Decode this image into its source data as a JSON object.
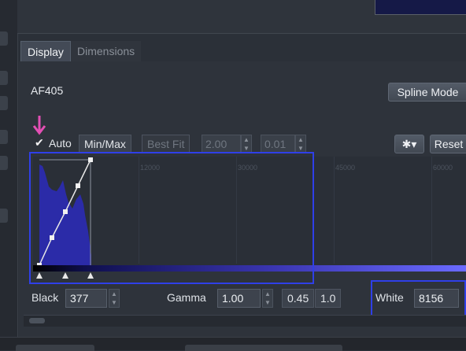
{
  "tabs": [
    "Display",
    "Dimensions"
  ],
  "channel": {
    "name": "AF405"
  },
  "spline_button": "Spline Mode",
  "auto": {
    "checked": true,
    "label": "Auto"
  },
  "modes": {
    "minmax": "Min/Max",
    "bestfit": "Best Fit"
  },
  "params": {
    "value1": "2.00",
    "value2": "0.01"
  },
  "settings_icon": "gear-icon",
  "reset_label": "Reset",
  "histogram": {
    "ticks": [
      "12000",
      "30000",
      "45000",
      "60000"
    ],
    "colors": {
      "fill": "#2b2ba8",
      "curve": "#e8e8e8",
      "highlight": "#2f3fe8",
      "annotation": "#e34fb4"
    }
  },
  "bottom": {
    "black_label": "Black",
    "black_value": "377",
    "gamma_label": "Gamma",
    "gamma_value": "1.00",
    "preset1": "0.45",
    "preset2": "1.0",
    "white_label": "White",
    "white_value": "8156"
  }
}
